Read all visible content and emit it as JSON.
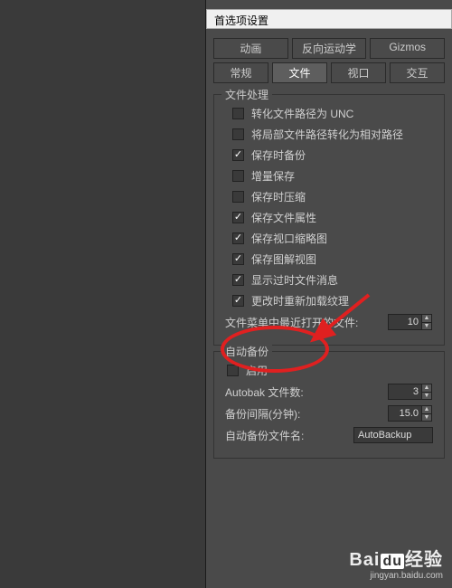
{
  "dialog": {
    "title": "首选项设置"
  },
  "tabs": {
    "row1": [
      {
        "label": "动画",
        "active": false
      },
      {
        "label": "反向运动学",
        "active": false
      },
      {
        "label": "Gizmos",
        "active": false
      }
    ],
    "row2": [
      {
        "label": "常规",
        "active": false
      },
      {
        "label": "文件",
        "active": true
      },
      {
        "label": "视口",
        "active": false
      },
      {
        "label": "交互",
        "active": false
      }
    ]
  },
  "fileHandling": {
    "legend": "文件处理",
    "options": [
      {
        "label": "转化文件路径为 UNC",
        "checked": false
      },
      {
        "label": "将局部文件路径转化为相对路径",
        "checked": false
      },
      {
        "label": "保存时备份",
        "checked": true
      },
      {
        "label": "增量保存",
        "checked": false
      },
      {
        "label": "保存时压缩",
        "checked": false
      },
      {
        "label": "保存文件属性",
        "checked": true
      },
      {
        "label": "保存视口缩略图",
        "checked": true
      },
      {
        "label": "保存图解视图",
        "checked": true
      },
      {
        "label": "显示过时文件消息",
        "checked": true
      },
      {
        "label": "更改时重新加载纹理",
        "checked": true
      }
    ],
    "recentFilesLabel": "文件菜单中最近打开的文件:",
    "recentFilesValue": "10"
  },
  "autoBackup": {
    "legend": "自动备份",
    "enable": {
      "label": "启用",
      "checked": false
    },
    "numFilesLabel": "Autobak 文件数:",
    "numFilesValue": "3",
    "intervalLabel": "备份间隔(分钟):",
    "intervalValue": "15.0",
    "nameLabel": "自动备份文件名:",
    "nameValue": "AutoBackup"
  },
  "watermark": {
    "brand1": "Bai",
    "brand2": "du",
    "brand3": "经验",
    "url": "jingyan.baidu.com"
  }
}
